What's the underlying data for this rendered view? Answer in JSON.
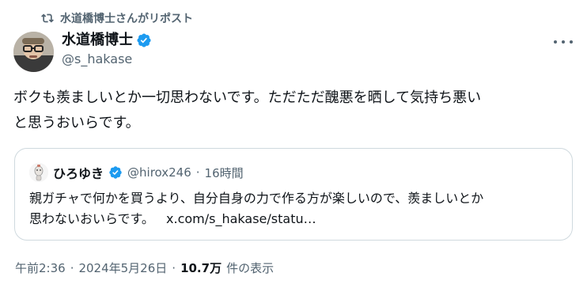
{
  "repost": {
    "label": "水道橋博士さんがリポスト",
    "icon": "repost-icon"
  },
  "author": {
    "name": "水道橋博士",
    "handle": "@s_hakase",
    "verified_icon": "verified-badge-icon",
    "verified_color": "#1d9bf0"
  },
  "more_icon": "more-options-icon",
  "tweet": {
    "line1": "ボクも羨ましいとか一切思わないです。ただただ醜悪を晒して気持ち悪い",
    "line2": "と思うおいらです。"
  },
  "quote": {
    "name": "ひろゆき",
    "handle": "@hirox246",
    "separator": "·",
    "time": "16時間",
    "line1": "親ガチャで何かを買うより、自分自身の力で作る方が楽しいので、羨ましいとか",
    "line2_text": "思わないおいらです。",
    "line2_link": "x.com/s_hakase/statu…"
  },
  "footer": {
    "time": "午前2:36",
    "sep1": "·",
    "date": "2024年5月26日",
    "sep2": "·",
    "views": "10.7万",
    "views_label": "件の表示"
  }
}
